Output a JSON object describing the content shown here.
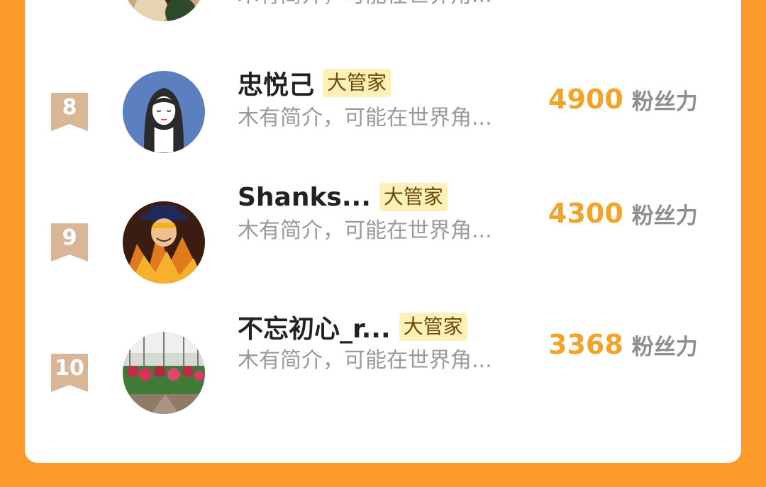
{
  "partial_top": {
    "bio": "木有简介，可能在世界角..."
  },
  "leaderboard": [
    {
      "rank": "8",
      "name": "忠悦己",
      "tag": "大管家",
      "bio": "木有简介，可能在世界角...",
      "fans": "4900",
      "fans_unit": "粉丝力",
      "avatar_icon": "girl-illustration-avatar"
    },
    {
      "rank": "9",
      "name": "Shanks...",
      "tag": "大管家",
      "bio": "木有简介，可能在世界角...",
      "fans": "4300",
      "fans_unit": "粉丝力",
      "avatar_icon": "anime-character-avatar"
    },
    {
      "rank": "10",
      "name": "不忘初心_r...",
      "tag": "大管家",
      "bio": "木有简介，可能在世界角...",
      "fans": "3368",
      "fans_unit": "粉丝力",
      "avatar_icon": "flower-greenhouse-avatar"
    }
  ],
  "colors": {
    "background": "#fb9a28",
    "fans_count": "#f3a326",
    "tag_bg": "#fdf0b8",
    "rank_badge": "#d9b698"
  }
}
